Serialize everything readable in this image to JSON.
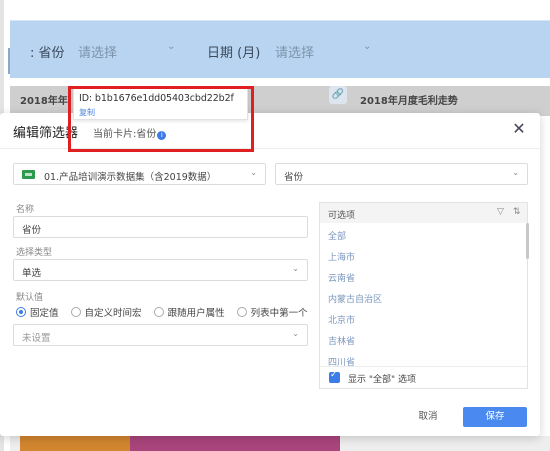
{
  "background": {
    "filter_bar": {
      "province_label": ": 省份",
      "province_placeholder": "请选择",
      "date_label": "日期 (月)",
      "date_placeholder": "请选择"
    },
    "card_left_title": "2018年年",
    "card_right_title": "2018年月度毛利走势"
  },
  "tooltip": {
    "id_text": "ID: b1b1676e1dd05403cbd22b2f",
    "copy_label": "复制"
  },
  "modal": {
    "title": "编辑筛选器",
    "current_card": "当前卡片:省份",
    "dataset_select": "01.产品培训演示数据集（含2019数据）",
    "field_select": "省份",
    "name_label": "名称",
    "name_value": "省份",
    "type_label": "选择类型",
    "type_value": "单选",
    "default_label": "默认值",
    "default_options": [
      "固定值",
      "自定义时间宏",
      "跟随用户属性",
      "列表中第一个"
    ],
    "default_selected": "固定值",
    "default_value": "未设置",
    "options_panel": {
      "title": "可选项",
      "items": [
        "全部",
        "上海市",
        "云南省",
        "内蒙古自治区",
        "北京市",
        "吉林省",
        "四川省"
      ],
      "show_all_label": "显示 \"全部\" 选项",
      "show_all_checked": true
    },
    "cancel_label": "取消",
    "save_label": "保存"
  },
  "colors": {
    "accent": "#4a8af0",
    "highlight": "#e02020",
    "filter_bar_bg": "#b8d4f0"
  }
}
